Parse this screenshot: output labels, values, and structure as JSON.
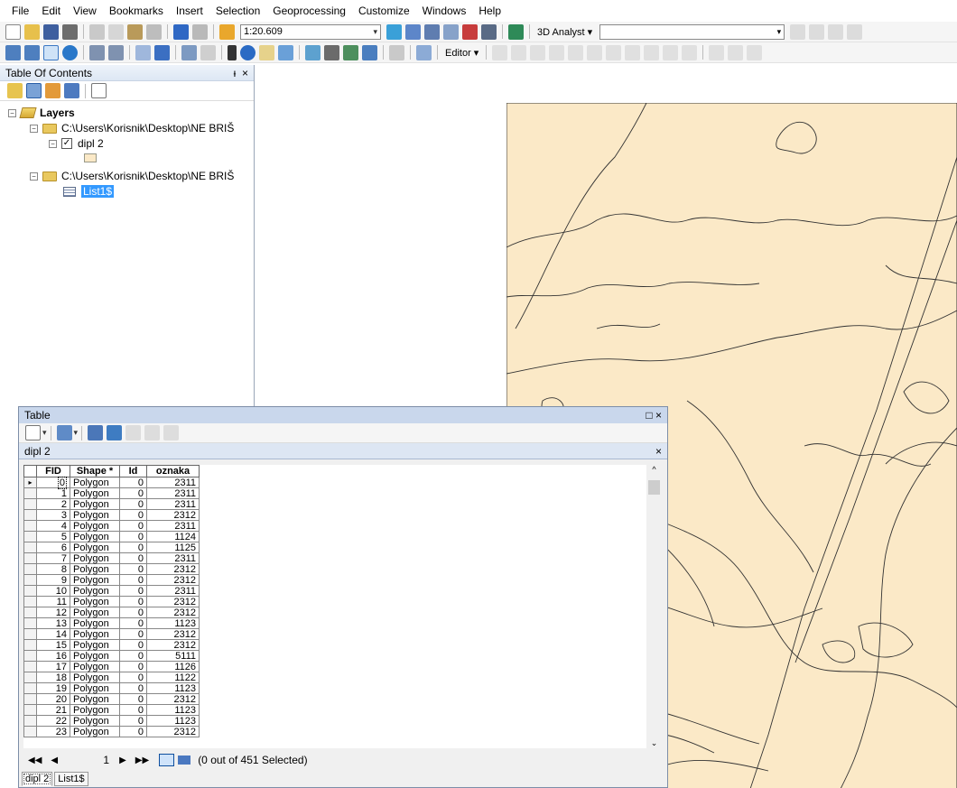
{
  "menu": [
    "File",
    "Edit",
    "View",
    "Bookmarks",
    "Insert",
    "Selection",
    "Geoprocessing",
    "Customize",
    "Windows",
    "Help"
  ],
  "toolbar": {
    "scale": "1:20.609",
    "analyst_label": "3D Analyst",
    "editor_label": "Editor",
    "accent": "#1f5fb8"
  },
  "toc": {
    "title": "Table Of Contents",
    "close_glyph": "×",
    "pin_glyph": "⬍",
    "layers_label": "Layers",
    "folder1": "C:\\Users\\Korisnik\\Desktop\\NE BRIŠ",
    "layer1": "dipl 2",
    "folder2": "C:\\Users\\Korisnik\\Desktop\\NE BRIŠ",
    "table1": "List1$",
    "swatch_color": "#fbe9c7"
  },
  "map": {
    "fill_color": "#fbe9c7",
    "line_color": "#333333"
  },
  "table_window": {
    "title": "Table",
    "tab_title": "dipl 2",
    "columns": [
      "FID",
      "Shape *",
      "Id",
      "oznaka"
    ],
    "rows": [
      [
        "0",
        "Polygon",
        "0",
        "2311"
      ],
      [
        "1",
        "Polygon",
        "0",
        "2311"
      ],
      [
        "2",
        "Polygon",
        "0",
        "2311"
      ],
      [
        "3",
        "Polygon",
        "0",
        "2312"
      ],
      [
        "4",
        "Polygon",
        "0",
        "2311"
      ],
      [
        "5",
        "Polygon",
        "0",
        "1124"
      ],
      [
        "6",
        "Polygon",
        "0",
        "1125"
      ],
      [
        "7",
        "Polygon",
        "0",
        "2311"
      ],
      [
        "8",
        "Polygon",
        "0",
        "2312"
      ],
      [
        "9",
        "Polygon",
        "0",
        "2312"
      ],
      [
        "10",
        "Polygon",
        "0",
        "2311"
      ],
      [
        "11",
        "Polygon",
        "0",
        "2312"
      ],
      [
        "12",
        "Polygon",
        "0",
        "2312"
      ],
      [
        "13",
        "Polygon",
        "0",
        "1123"
      ],
      [
        "14",
        "Polygon",
        "0",
        "2312"
      ],
      [
        "15",
        "Polygon",
        "0",
        "2312"
      ],
      [
        "16",
        "Polygon",
        "0",
        "5111"
      ],
      [
        "17",
        "Polygon",
        "0",
        "1126"
      ],
      [
        "18",
        "Polygon",
        "0",
        "1122"
      ],
      [
        "19",
        "Polygon",
        "0",
        "1123"
      ],
      [
        "20",
        "Polygon",
        "0",
        "2312"
      ],
      [
        "21",
        "Polygon",
        "0",
        "1123"
      ],
      [
        "22",
        "Polygon",
        "0",
        "1123"
      ],
      [
        "23",
        "Polygon",
        "0",
        "2312"
      ]
    ],
    "record_number": "1",
    "selection_status": "(0 out of 451 Selected)",
    "bottom_tabs": [
      "dipl 2",
      "List1$"
    ]
  }
}
